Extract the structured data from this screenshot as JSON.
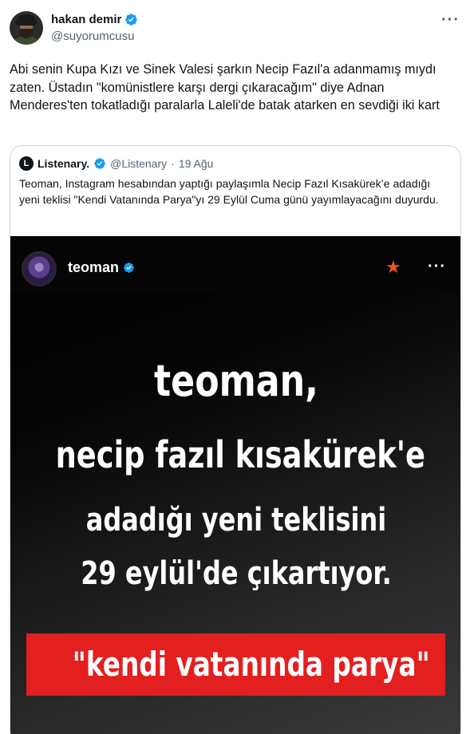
{
  "author": {
    "display_name": "hakan demir",
    "handle": "@suyorumcusu",
    "avatar_icon": "user-avatar",
    "verified_icon": "verified-badge-icon",
    "verified_color": "#1d9bf0"
  },
  "more_label": "···",
  "tweet": {
    "text": "Abi senin Kupa Kızı ve Sinek Valesi şarkın Necip Fazıl'a adanmamış mıydı zaten. Üstadın \"komünistlere karşı dergi çıkaracağım\" diye Adnan Menderes'ten tokatladığı paralarla Laleli'de batak atarken en sevdiği iki kart"
  },
  "quoted": {
    "logo_letter": "L",
    "display_name": "Listenary.",
    "handle": "@Listenary",
    "separator": "·",
    "date": "19 Ağu",
    "text": "Teoman, Instagram hesabından yaptığı paylaşımla Necip Fazıl Kısakürek’e adadığı yeni teklisi \"Kendi Vatanında Parya\"yı 29 Eylül Cuma günü yayımlayacağını duyurdu."
  },
  "media": {
    "ig_username": "teoman",
    "star_icon": "star-icon",
    "star_color": "#f4511e",
    "ig_more": "···",
    "headline_lines": [
      "teoman,",
      "necip fazıl kısakürek'e",
      "adadığı yeni teklisini",
      "29 eylül'de çıkartıyor."
    ],
    "banner_text": "\"kendi vatanında parya\"",
    "banner_color": "#e41f1f"
  }
}
